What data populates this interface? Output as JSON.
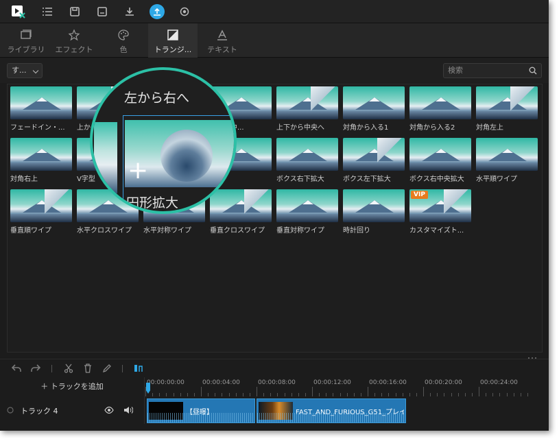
{
  "toolbar": {
    "icons": [
      "app-logo-icon",
      "list-icon",
      "save-icon",
      "save-as-icon",
      "download-icon",
      "export-icon",
      "record-icon"
    ],
    "accent": "#2ea8e6"
  },
  "tabs": [
    {
      "label": "ライブラリ",
      "icon": "library-icon"
    },
    {
      "label": "エフェクト",
      "icon": "effects-icon"
    },
    {
      "label": "色",
      "icon": "palette-icon"
    },
    {
      "label": "トランジ...",
      "icon": "transition-icon",
      "active": true
    },
    {
      "label": "テキスト",
      "icon": "text-icon"
    }
  ],
  "filter": {
    "dropdown": "す...",
    "search_placeholder": "検索"
  },
  "transitions": [
    "フェードイン・...",
    "上から",
    "左から右へ",
    "ドから中...",
    "上下から中央へ",
    "対角から入る1",
    "対角から入る2",
    "対角左上",
    "対角右上",
    "V字型",
    "円形拡大",
    "拡大",
    "ボクス右下拡大",
    "ボクス左下拡大",
    "ボクス右中央拡大",
    "水平順ワイプ",
    "垂直順ワイプ",
    "水平クロスワイプ",
    "水平対称ワイプ",
    "垂直クロスワイプ",
    "垂直対称ワイプ",
    "時計回り",
    "カスタマイズト..."
  ],
  "vip_badge": "VIP",
  "magnifier": {
    "top_text": "左から右へ",
    "label": "円形拡大",
    "plus": "+"
  },
  "timeline": {
    "add_track": "＋ トラックを追加",
    "ticks": [
      "00:00:00:00",
      "00:00:04:00",
      "00:00:08:00",
      "00:00:12:00",
      "00:00:16:00",
      "00:00:20:00",
      "00:00:24:00"
    ],
    "track_name": "トラック 4",
    "clips": [
      {
        "title": "【昼曝】"
      },
      {
        "title": "FAST_AND_FURIOUS_G51_プレイ"
      }
    ]
  }
}
